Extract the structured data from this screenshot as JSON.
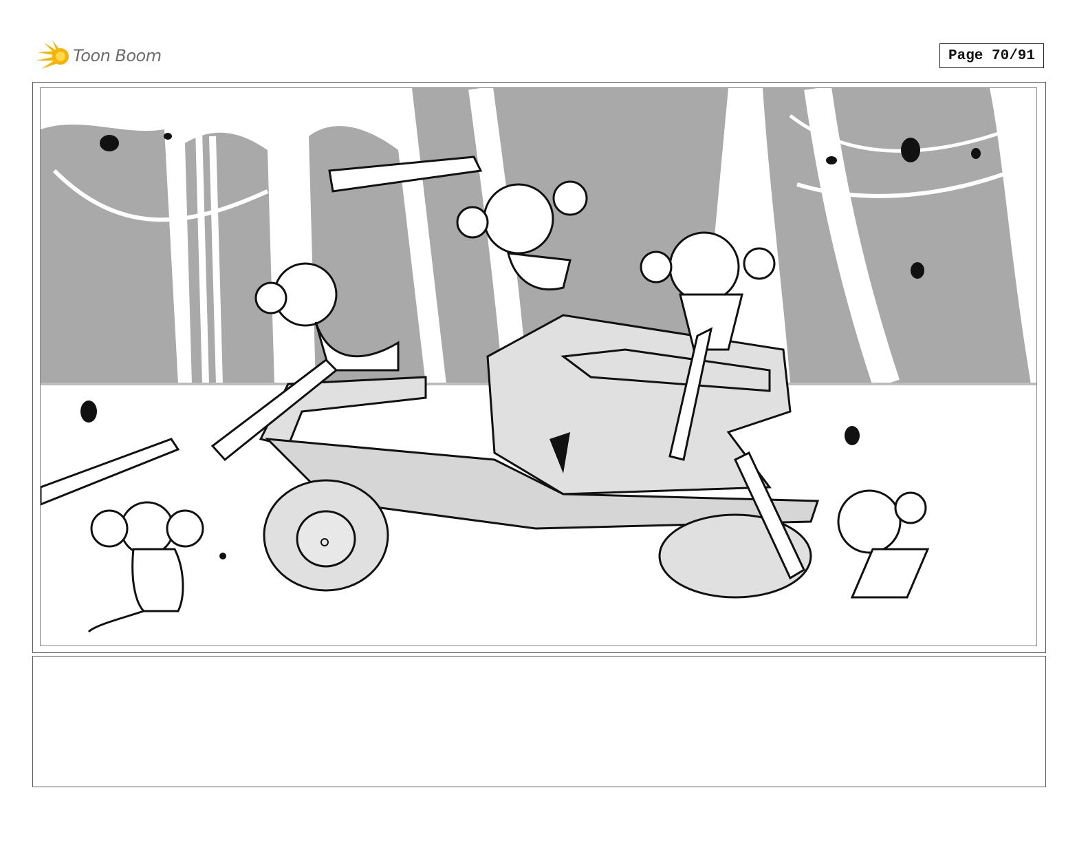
{
  "header": {
    "logo_text": "Toon Boom",
    "logo_icon": "starburst-icon",
    "page_label": "Page 70/91"
  },
  "panel": {
    "scene_description_icon": "storyboard-drawing"
  },
  "colors": {
    "logo_yellow": "#f5b400",
    "background_gray": "#a9a9a9",
    "ground_gray": "#e6e6e6",
    "line": "#111111"
  },
  "notes": {
    "text": ""
  }
}
